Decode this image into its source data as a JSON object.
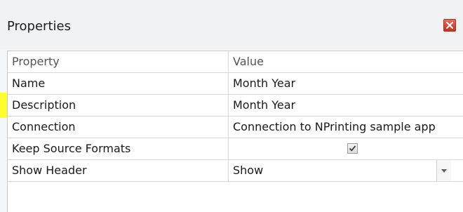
{
  "panel": {
    "title": "Properties",
    "close_icon": "close-icon",
    "close_color": "#d9432f"
  },
  "grid": {
    "columns": [
      "Property",
      "Value"
    ],
    "rows": [
      {
        "property": "Name",
        "value": "Month Year",
        "type": "text"
      },
      {
        "property": "Description",
        "value": "Month Year",
        "type": "text"
      },
      {
        "property": "Connection",
        "value": "Connection to NPrinting sample app",
        "type": "text"
      },
      {
        "property": "Keep Source Formats",
        "value": true,
        "type": "checkbox",
        "highlighted": true,
        "highlight_color": "#ffff30"
      },
      {
        "property": "Show Header",
        "value": "Show",
        "type": "dropdown"
      }
    ]
  }
}
